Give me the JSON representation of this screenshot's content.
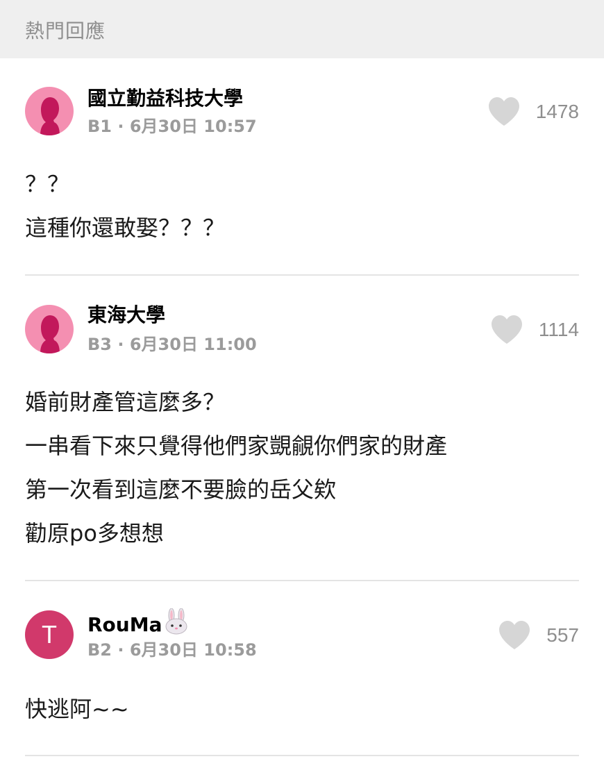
{
  "section": {
    "title": "熱門回應"
  },
  "comments": [
    {
      "author": "國立勤益科技大學",
      "floor": "B1",
      "separator": "·",
      "time": "6月30日 10:57",
      "likes": "1478",
      "avatar": "female-silhouette-icon",
      "lines": [
        "？？",
        "這種你還敢娶？？？"
      ]
    },
    {
      "author": "東海大學",
      "floor": "B3",
      "separator": "·",
      "time": "6月30日 11:00",
      "likes": "1114",
      "avatar": "female-silhouette-icon",
      "lines": [
        "婚前財產管這麼多？",
        "一串看下來只覺得他們家覬覦你們家的財產",
        "第一次看到這麼不要臉的岳父欸",
        "勸原po多想想"
      ]
    },
    {
      "author": "RouMa",
      "floor": "B2",
      "separator": "·",
      "time": "6月30日 10:58",
      "likes": "557",
      "avatar_letter": "T",
      "author_emoji": "bunny-face-icon",
      "lines": [
        "快逃阿~~"
      ]
    }
  ],
  "colors": {
    "header_bg": "#efefef",
    "female_avatar": "#f48fb1",
    "letter_avatar": "#d1396b",
    "heart": "#d6d6d6",
    "meta_text": "#9b9b9b"
  }
}
